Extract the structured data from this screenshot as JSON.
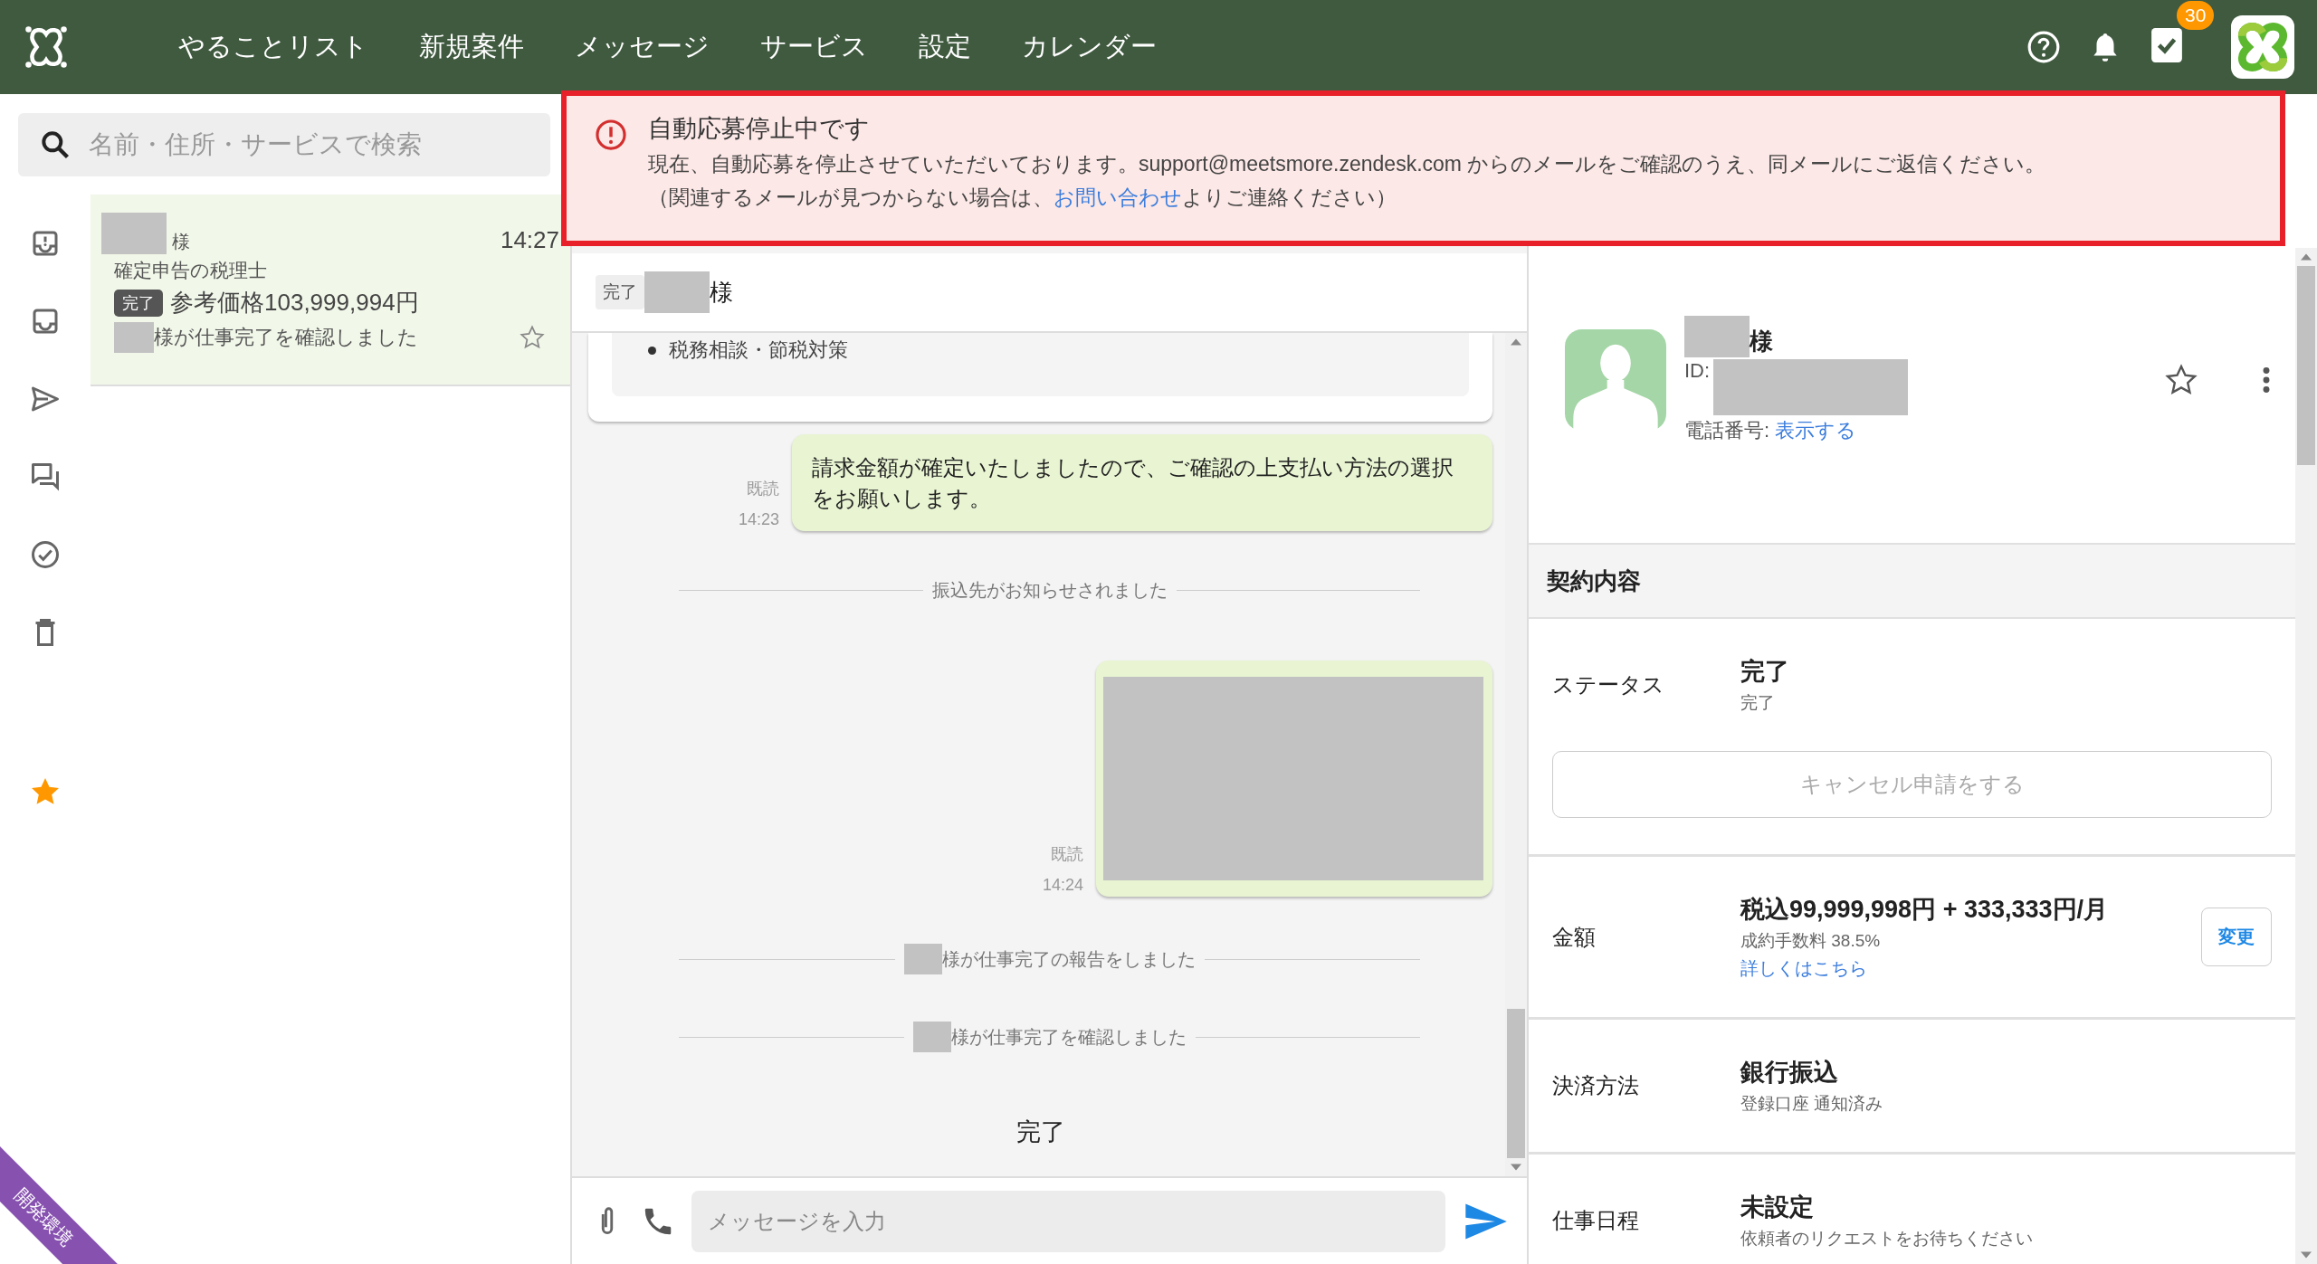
{
  "nav": {
    "items": [
      {
        "label": "やることリスト"
      },
      {
        "label": "新規案件"
      },
      {
        "label": "メッセージ"
      },
      {
        "label": "サービス"
      },
      {
        "label": "設定"
      },
      {
        "label": "カレンダー"
      }
    ],
    "task_badge": "30"
  },
  "search": {
    "placeholder": "名前・住所・サービスで検索"
  },
  "sidebar": {
    "items": [
      {
        "kind": "inbox-alert"
      },
      {
        "kind": "inbox"
      },
      {
        "kind": "send"
      },
      {
        "kind": "forum"
      },
      {
        "kind": "check"
      },
      {
        "kind": "trash"
      },
      {
        "kind": "star"
      }
    ]
  },
  "conversation": {
    "suffix": "様",
    "time": "14:27",
    "service": "確定申告の税理士",
    "status": "完了",
    "price": "参考価格103,999,994円",
    "last_message": "様が仕事完了を確認しました",
    "starred": false
  },
  "alert": {
    "title": "自動応募停止中です",
    "body": "現在、自動応募を停止させていただいております。support@meetsmore.zendesk.com からのメールをご確認のうえ、同メールにご返信ください。",
    "note_before": "（関連するメールが見つからない場合は、",
    "note_link": "お問い合わせ",
    "note_after": "よりご連絡ください）"
  },
  "chat": {
    "status": "完了",
    "suffix": "様",
    "messages": [
      {
        "kind": "list_item",
        "text": "税務相談・節税対策"
      },
      {
        "kind": "bubble",
        "read": "既読",
        "time": "14:23",
        "text": "請求金額が確定いたしましたので、ご確認の上支払い方法の選択をお願いします。"
      },
      {
        "kind": "event",
        "text": "振込先がお知らせされました",
        "redacted": false
      },
      {
        "kind": "image",
        "read": "既読",
        "time": "14:24"
      },
      {
        "kind": "event",
        "text": "様が仕事完了の報告をしました",
        "redacted": true
      },
      {
        "kind": "event",
        "text": "様が仕事完了を確認しました",
        "redacted": true
      },
      {
        "kind": "status",
        "text": "完了"
      }
    ],
    "composer": {
      "placeholder": "メッセージを入力"
    }
  },
  "profile": {
    "suffix": "様",
    "id_label": "ID:",
    "phone_label": "電話番号:",
    "phone_link": "表示する",
    "starred": false
  },
  "contract": {
    "title": "契約内容",
    "rows": [
      {
        "label": "ステータス",
        "value": "完了",
        "sub": "完了",
        "button": "キャンセル申請をする",
        "button_disabled": true
      },
      {
        "label": "金額",
        "value": "税込99,999,998円 + 333,333円/月",
        "sub": "成約手数料 38.5%",
        "link": "詳しくはこちら",
        "side_button": "変更"
      },
      {
        "label": "決済方法",
        "value": "銀行振込",
        "sub": "登録口座 通知済み"
      },
      {
        "label": "仕事日程",
        "value": "未設定",
        "sub": "依頼者のリクエストをお待ちください"
      }
    ]
  },
  "env_ribbon": "開発環境"
}
